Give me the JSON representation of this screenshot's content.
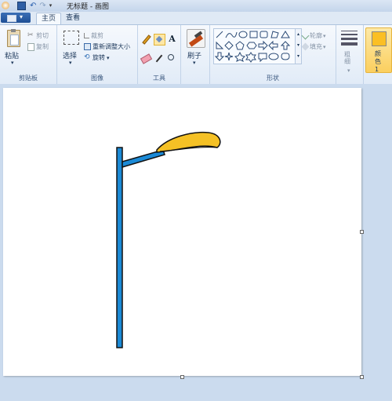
{
  "window": {
    "title": "无标题 - 画图"
  },
  "tabs": [
    {
      "label": "主页",
      "active": true
    },
    {
      "label": "查看",
      "active": false
    }
  ],
  "ribbon": {
    "clipboard": {
      "paste": "粘贴",
      "cut": "剪切",
      "copy": "复制",
      "group_label": "剪贴板"
    },
    "image": {
      "select": "选择",
      "crop": "裁剪",
      "resize": "重新调整大小",
      "rotate": "旋转",
      "group_label": "图像"
    },
    "tools": {
      "group_label": "工具"
    },
    "brushes": {
      "label": "刷子"
    },
    "shapes": {
      "outline": "轮廓",
      "fill": "填充",
      "group_label": "形状"
    },
    "size": {
      "label": "粗细"
    },
    "color1": {
      "label": "颜色 1",
      "swatch": "#fbbf24"
    }
  },
  "drawing": {
    "pole_color": "#1b8ad6",
    "lamp_color": "#f5c125",
    "outline_color": "#111111"
  }
}
